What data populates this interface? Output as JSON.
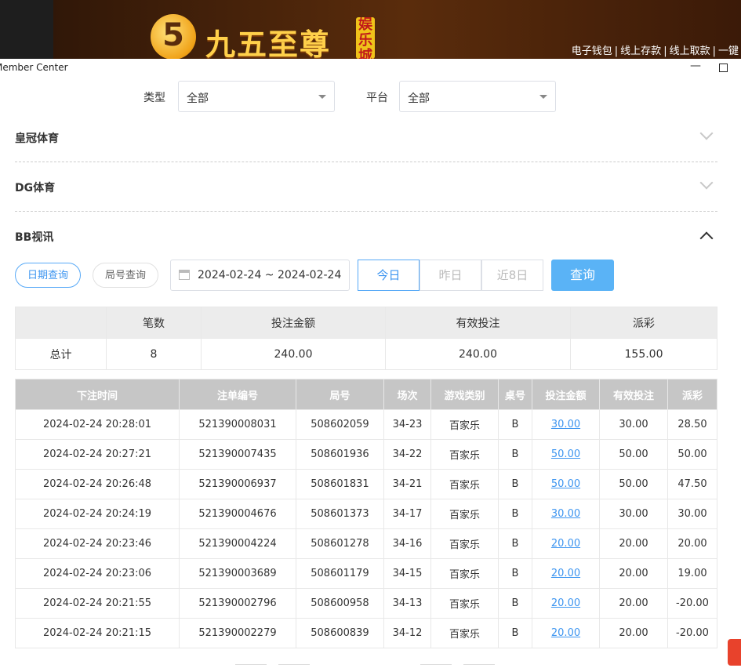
{
  "banner": {
    "logo_digit": "5",
    "logo_text": "九五至尊",
    "logo_tag": "娱乐城",
    "nav": [
      "电子钱包",
      "线上存款",
      "线上取款",
      "一键"
    ]
  },
  "window": {
    "title": "Member Center"
  },
  "filters": {
    "type_label": "类型",
    "type_value": "全部",
    "platform_label": "平台",
    "platform_value": "全部"
  },
  "sections": [
    "皇冠体育",
    "DG体育",
    "BB视讯"
  ],
  "query_bar": {
    "date_tab": "日期查询",
    "round_tab": "局号查询",
    "date_range": "2024-02-24 ~ 2024-02-24",
    "today": "今日",
    "yesterday": "昨日",
    "last8": "近8日",
    "search": "查询"
  },
  "summary": {
    "headers": [
      "",
      "笔数",
      "投注金额",
      "有效投注",
      "派彩"
    ],
    "row": [
      "总计",
      "8",
      "240.00",
      "240.00",
      "155.00"
    ]
  },
  "detail": {
    "headers": [
      "下注时间",
      "注单编号",
      "局号",
      "场次",
      "游戏类别",
      "桌号",
      "投注金额",
      "有效投注",
      "派彩"
    ],
    "rows": [
      [
        "2024-02-24 20:28:01",
        "521390008031",
        "508602059",
        "34-23",
        "百家乐",
        "B",
        "30.00",
        "30.00",
        "28.50"
      ],
      [
        "2024-02-24 20:27:21",
        "521390007435",
        "508601936",
        "34-22",
        "百家乐",
        "B",
        "50.00",
        "50.00",
        "50.00"
      ],
      [
        "2024-02-24 20:26:48",
        "521390006937",
        "508601831",
        "34-21",
        "百家乐",
        "B",
        "50.00",
        "50.00",
        "47.50"
      ],
      [
        "2024-02-24 20:24:19",
        "521390004676",
        "508601373",
        "34-17",
        "百家乐",
        "B",
        "30.00",
        "30.00",
        "30.00"
      ],
      [
        "2024-02-24 20:23:46",
        "521390004224",
        "508601278",
        "34-16",
        "百家乐",
        "B",
        "20.00",
        "20.00",
        "20.00"
      ],
      [
        "2024-02-24 20:23:06",
        "521390003689",
        "508601179",
        "34-15",
        "百家乐",
        "B",
        "20.00",
        "20.00",
        "19.00"
      ],
      [
        "2024-02-24 20:21:55",
        "521390002796",
        "508600958",
        "34-13",
        "百家乐",
        "B",
        "20.00",
        "20.00",
        "-20.00"
      ],
      [
        "2024-02-24 20:21:15",
        "521390002279",
        "508600839",
        "34-12",
        "百家乐",
        "B",
        "20.00",
        "20.00",
        "-20.00"
      ]
    ]
  },
  "colors": {
    "accent": "#3d95f0",
    "negative": "#e3413f",
    "header_gray": "#c6c6c6"
  }
}
